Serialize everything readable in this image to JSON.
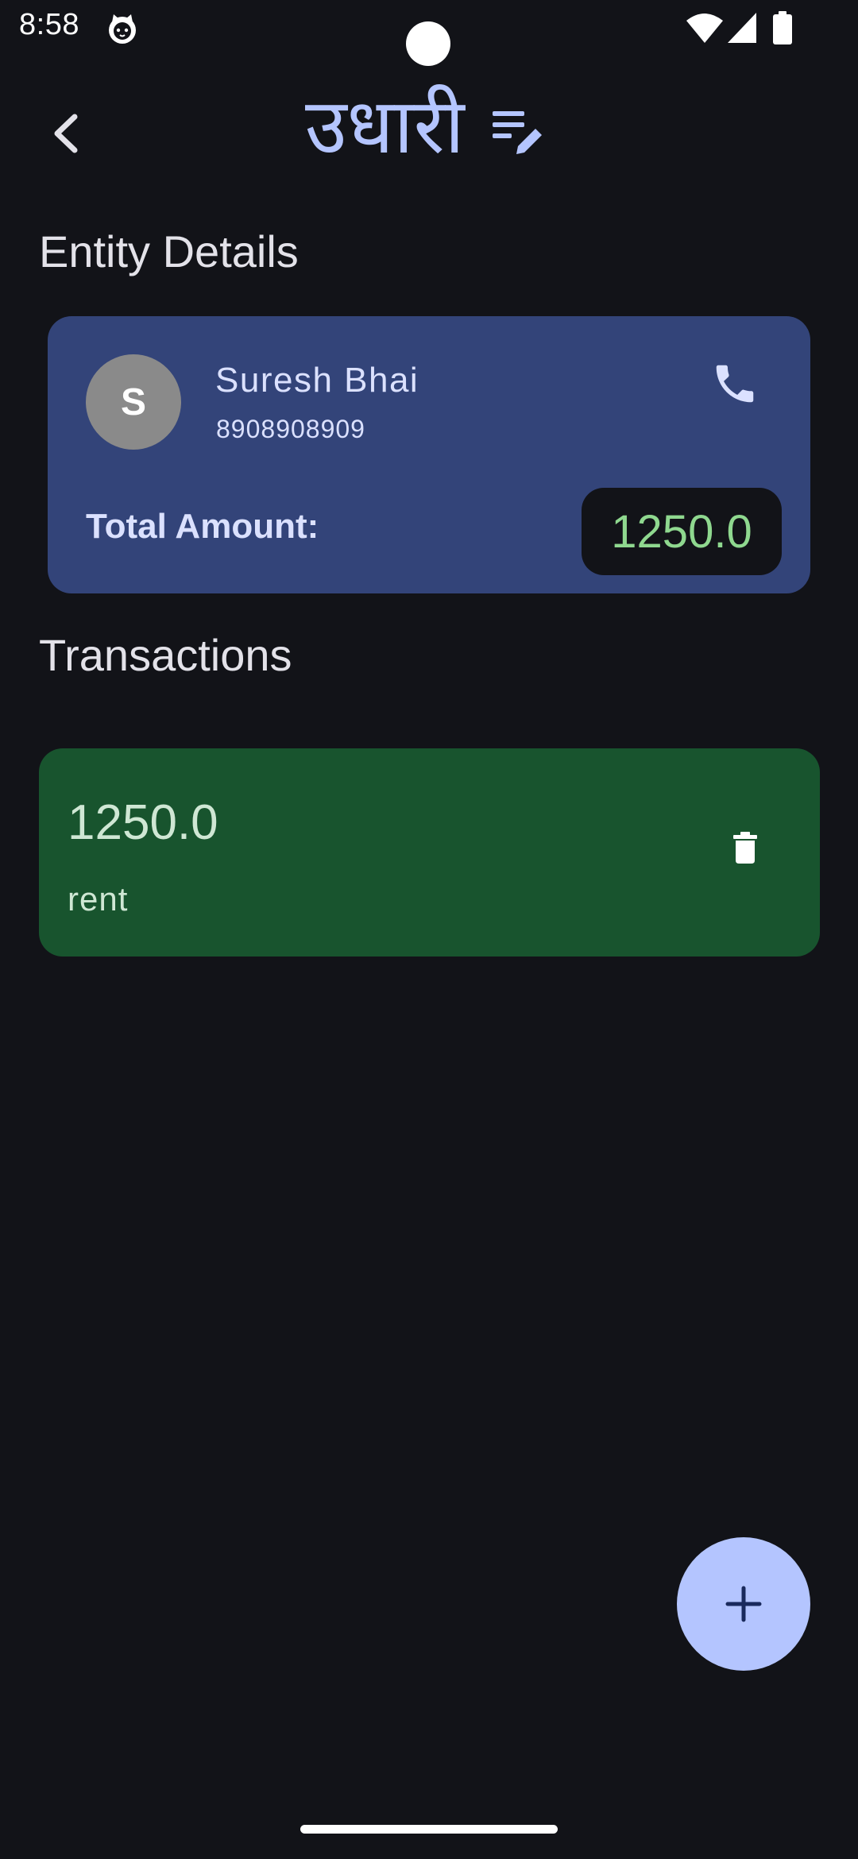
{
  "status_bar": {
    "time": "8:58",
    "icons": [
      "cat-notification-icon",
      "wifi-icon",
      "signal-icon",
      "battery-icon"
    ]
  },
  "top_bar": {
    "title": "उधारी",
    "back_icon": "back-arrow-icon",
    "title_icon": "list-edit-icon"
  },
  "entity_section": {
    "heading": "Entity Details",
    "card": {
      "avatar_letter": "S",
      "name": "Suresh Bhai",
      "phone": "8908908909",
      "call_icon": "phone-icon",
      "total_label": "Total Amount:",
      "total_value": "1250.0"
    }
  },
  "transactions_section": {
    "heading": "Transactions",
    "items": [
      {
        "amount": "1250.0",
        "description": "rent",
        "delete_icon": "trash-icon"
      }
    ]
  },
  "fab": {
    "icon": "plus-icon"
  },
  "colors": {
    "background": "#121318",
    "accent": "#b4c5ff",
    "entity_card": "#334479",
    "transaction_card": "#18542e",
    "total_value": "#8fd88f"
  }
}
